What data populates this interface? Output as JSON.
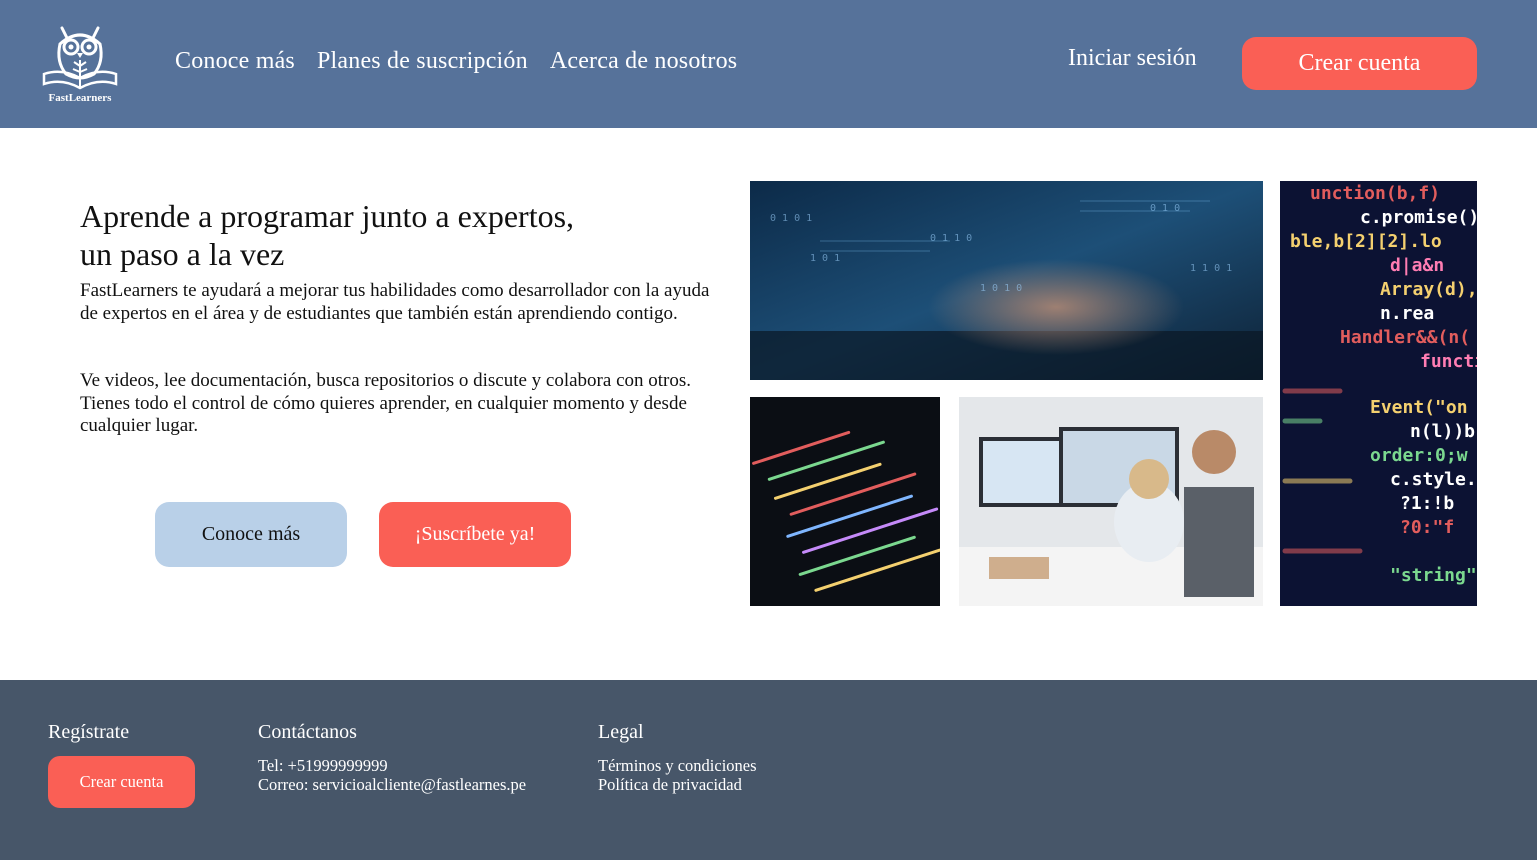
{
  "header": {
    "logo_text": "FastLearners",
    "nav": [
      "Conoce más",
      "Planes de suscripción",
      "Acerca de nosotros"
    ],
    "login_label": "Iniciar sesión",
    "signup_label": "Crear cuenta"
  },
  "hero": {
    "title_line1": "Aprende a programar junto a expertos,",
    "title_line2": "un paso a la vez",
    "paragraph1": "FastLearners te ayudará a mejorar tus habilidades como desarrollador con la ayuda de expertos en el área y de estudiantes que también están aprendiendo contigo.",
    "paragraph2": "Ve videos, lee documentación, busca repositorios o discute y colabora con otros. Tienes todo el control de cómo quieres aprender, en cualquier momento y desde cualquier lugar.",
    "btn_more": "Conoce más",
    "btn_subscribe": "¡Suscríbete ya!"
  },
  "footer": {
    "register": {
      "title": "Regístrate",
      "button": "Crear cuenta"
    },
    "contact": {
      "title": "Contáctanos",
      "phone": "Tel: +51999999999",
      "email": "Correo: servicioalcliente@fastlearnes.pe"
    },
    "legal": {
      "title": "Legal",
      "terms": "Términos y condiciones",
      "privacy": "Política de privacidad"
    }
  },
  "colors": {
    "header_bg": "#56729a",
    "footer_bg": "#475669",
    "accent": "#fa5f55",
    "secondary_button": "#b9d0e8"
  },
  "images": {
    "hero_image_1": "hands-typing-laptop-code-photo",
    "hero_image_2": "code-screen-photo",
    "hero_image_3": "people-at-computers-photo",
    "hero_image_4": "colorful-code-closeup-photo"
  }
}
